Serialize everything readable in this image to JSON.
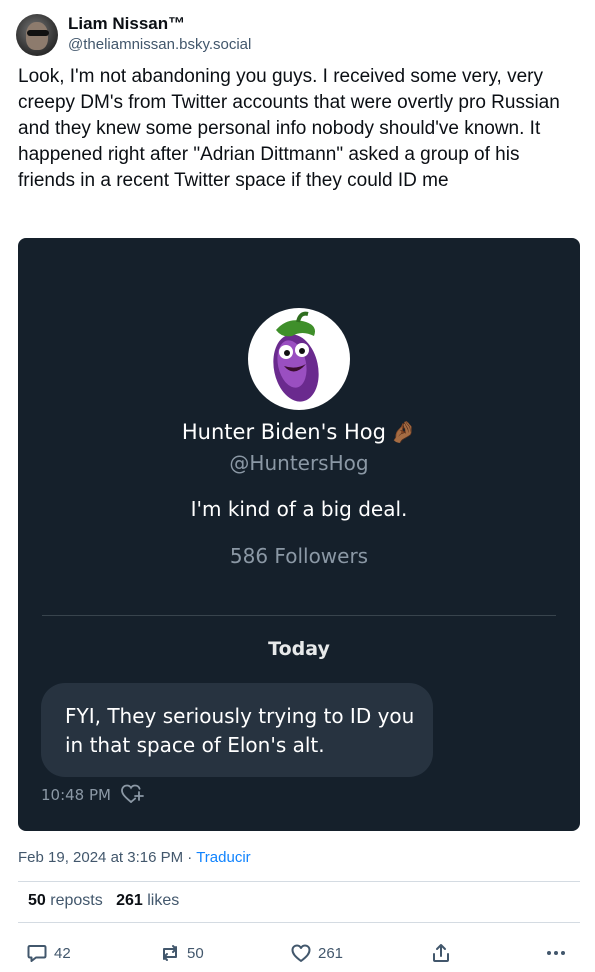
{
  "author": {
    "display_name": "Liam Nissan™",
    "handle": "@theliamnissan.bsky.social",
    "avatar_icon": "user-avatar-photo"
  },
  "post": {
    "text": "Look, I'm not abandoning you guys. I received some very, very creepy DM's from Twitter accounts that were overtly pro Russian and they knew some personal info nobody should've known. It happened right after \"Adrian Dittmann\" asked a group of his friends in a recent Twitter space if they could ID me"
  },
  "embed": {
    "background": "#15202b",
    "profile_name": "Hunter Biden's Hog",
    "profile_emoji": "🤌🏾",
    "profile_handle": "@HuntersHog",
    "bio": "I'm kind of a big deal.",
    "followers": "586 Followers",
    "date_separator": "Today",
    "message": "FYI,  They seriously trying to ID you in that space of Elon's alt.",
    "message_time": "10:48 PM",
    "avatar_icon": "eggplant-icon"
  },
  "meta": {
    "timestamp": "Feb 19, 2024 at 3:16 PM",
    "separator": "·",
    "translate_label": "Traducir",
    "translate_color": "#1083fe"
  },
  "stats": {
    "reposts_count": "50",
    "reposts_label": "reposts",
    "likes_count": "261",
    "likes_label": "likes"
  },
  "actions": {
    "reply_count": "42",
    "repost_count": "50",
    "like_count": "261"
  }
}
